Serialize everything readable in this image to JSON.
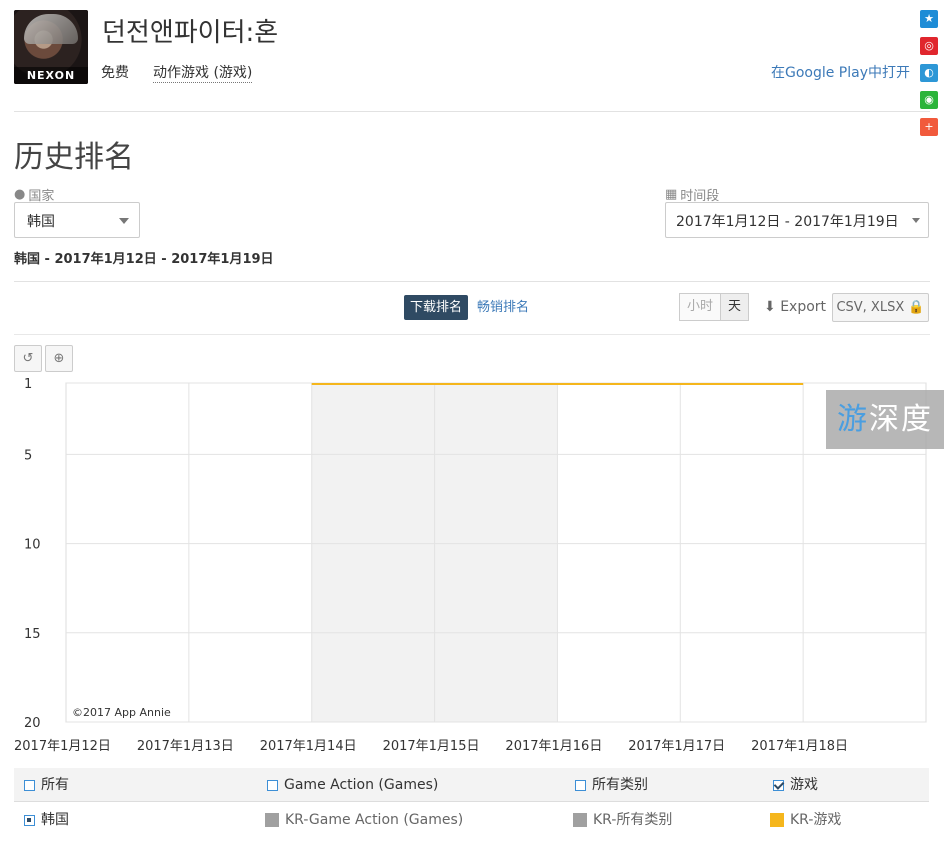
{
  "app": {
    "title": "던전앤파이터:혼",
    "icon_brand": "NEXON",
    "price": "免费",
    "category": "动作游戏 (游戏)",
    "play_link": "在Google Play中打开"
  },
  "share_icons": [
    {
      "name": "qzone-icon",
      "color": "#1e8cd6",
      "glyph": "★"
    },
    {
      "name": "weibo-icon",
      "color": "#e0262d",
      "glyph": "◎"
    },
    {
      "name": "tencent-weibo-icon",
      "color": "#2d97d6",
      "glyph": "◐"
    },
    {
      "name": "wechat-icon",
      "color": "#2bb43a",
      "glyph": "◉"
    },
    {
      "name": "more-share-icon",
      "color": "#f15a3c",
      "glyph": "+"
    }
  ],
  "page_title": "历史排名",
  "filters": {
    "country_label": "国家",
    "country_value": "韩国",
    "range_label": "时间段",
    "range_value": "2017年1月12日 - 2017年1月19日"
  },
  "subtitle": "韩国 - 2017年1月12日 - 2017年1月19日",
  "toolbar": {
    "tab_downloads": "下载排名",
    "tab_grossing": "畅销排名",
    "hour_label": "小时",
    "day_label": "天",
    "export_label": "Export",
    "csv_label": "CSV, XLSX"
  },
  "chart_tools": {
    "reset_glyph": "↺",
    "zoom_glyph": "⊕"
  },
  "watermark": {
    "part1": "游",
    "part2": "深度"
  },
  "chart_data": {
    "type": "line",
    "x": [
      "2017年1月12日",
      "2017年1月13日",
      "2017年1月14日",
      "2017年1月15日",
      "2017年1月16日",
      "2017年1月17日",
      "2017年1月18日"
    ],
    "y_ticks": [
      1,
      5,
      10,
      15,
      20
    ],
    "ylim": [
      1,
      20
    ],
    "y_reversed": true,
    "grid": true,
    "shaded_weekend": [
      "2017年1月14日",
      "2017年1月16日"
    ],
    "copyright": "©2017 App Annie",
    "series": [
      {
        "name": "KR-游戏",
        "color": "#f5b61c",
        "points": [
          {
            "x": "2017年1月14日",
            "y": 1
          },
          {
            "x": "2017年1月15日",
            "y": 1
          },
          {
            "x": "2017年1月16日",
            "y": 1
          },
          {
            "x": "2017年1月17日",
            "y": 1
          },
          {
            "x": "2017年1月18日",
            "y": 1
          }
        ]
      }
    ]
  },
  "legend": {
    "row1": [
      {
        "label": "所有",
        "checked": false
      },
      {
        "label": "Game Action (Games)",
        "checked": false
      },
      {
        "label": "所有类别",
        "checked": false
      },
      {
        "label": "游戏",
        "checked": true
      }
    ],
    "row2": [
      {
        "label": "韩国",
        "kind": "radio"
      },
      {
        "label": "KR-Game Action (Games)",
        "color": "#a0a0a0"
      },
      {
        "label": "KR-所有类别",
        "color": "#a0a0a0"
      },
      {
        "label": "KR-游戏",
        "color": "#f5b61c"
      }
    ]
  }
}
